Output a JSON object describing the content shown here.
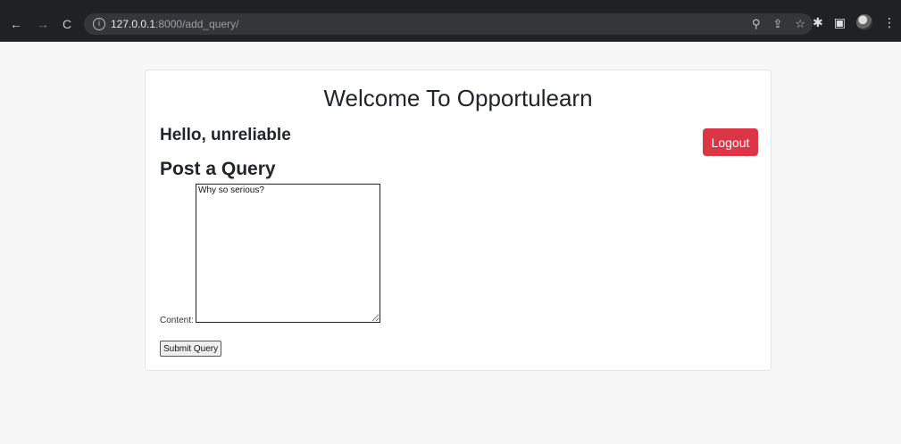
{
  "browser": {
    "url_host": "127.0.0.1",
    "url_path": ":8000/add_query/",
    "icons": [
      "back-icon",
      "forward-icon",
      "reload-icon",
      "info-icon",
      "zoom-icon",
      "share-icon",
      "bookmark-star-icon",
      "extensions-icon",
      "side-panel-icon",
      "profile-avatar",
      "menu-icon"
    ]
  },
  "page": {
    "title": "Welcome To Opportulearn",
    "greeting": "Hello, unreliable",
    "logout_label": "Logout",
    "section_title": "Post a Query",
    "form": {
      "content_label": "Content:",
      "content_value": "Why so serious?",
      "submit_label": "Submit Query"
    }
  },
  "colors": {
    "logout_button": "#dc3545",
    "browser_bar": "#202124"
  }
}
